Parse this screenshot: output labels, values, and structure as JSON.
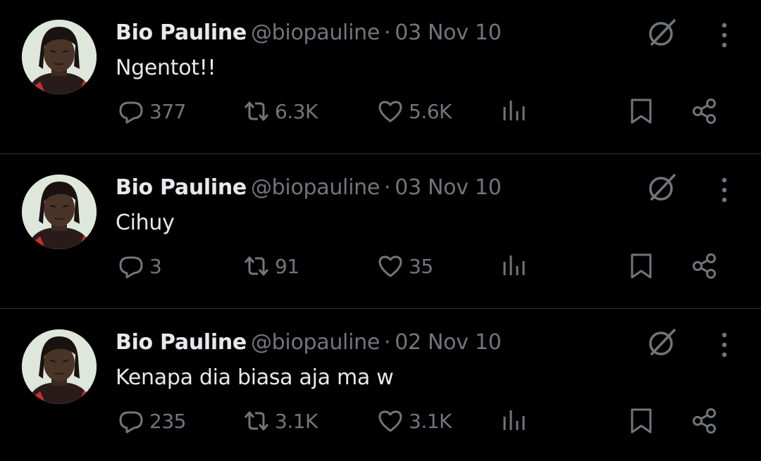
{
  "tweets": [
    {
      "author_name": "Bio Pauline",
      "handle": "@biopauline",
      "separator": "·",
      "date": "03 Nov 10",
      "text": "Ngentot!!",
      "replies": "377",
      "retweets": "6.3K",
      "likes": "5.6K"
    },
    {
      "author_name": "Bio Pauline",
      "handle": "@biopauline",
      "separator": "·",
      "date": "03 Nov 10",
      "text": "Cihuy",
      "replies": "3",
      "retweets": "91",
      "likes": "35"
    },
    {
      "author_name": "Bio Pauline",
      "handle": "@biopauline",
      "separator": "·",
      "date": "02 Nov 10",
      "text": "Kenapa dia biasa aja ma w",
      "replies": "235",
      "retweets": "3.1K",
      "likes": "3.1K"
    }
  ],
  "icons": {
    "grok": "grok-icon",
    "more": "more-options-icon",
    "reply": "reply-icon",
    "retweet": "retweet-icon",
    "like": "heart-icon",
    "views": "views-icon",
    "bookmark": "bookmark-icon",
    "share": "share-icon"
  },
  "colors": {
    "background": "#000000",
    "primary_text": "#e7e9ea",
    "secondary_text": "#71767b",
    "divider": "#2f3336"
  }
}
